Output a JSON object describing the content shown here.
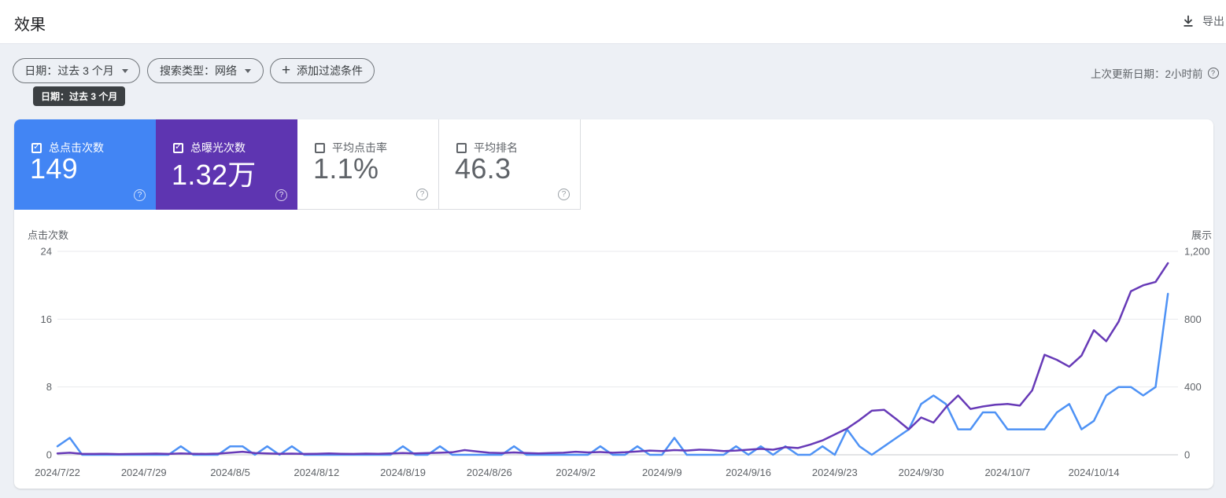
{
  "header": {
    "title": "效果",
    "export_label": "导出"
  },
  "filters": {
    "chips": [
      {
        "label": "日期：过去 3 个月"
      },
      {
        "label": "搜索类型：网络"
      },
      {
        "label": "添加过滤条件"
      }
    ],
    "tooltip": "日期：过去 3 个月",
    "last_updated": "上次更新日期：2小时前",
    "info_icon_symbol": "?"
  },
  "metric_cards": [
    {
      "label": "总点击次数",
      "value": "149",
      "checked": true,
      "color": "#4285f4"
    },
    {
      "label": "总曝光次数",
      "value": "1.32万",
      "checked": true,
      "color": "#5e35b1"
    },
    {
      "label": "平均点击率",
      "value": "1.1%",
      "checked": false,
      "color": "#ffffff"
    },
    {
      "label": "平均排名",
      "value": "46.3",
      "checked": false,
      "color": "#ffffff"
    }
  ],
  "chart_data": {
    "type": "line",
    "start_date": "2024/7/22",
    "interval": "day",
    "x_tick_labels": [
      "2024/7/22",
      "2024/7/29",
      "2024/8/5",
      "2024/8/12",
      "2024/8/19",
      "2024/8/26",
      "2024/9/2",
      "2024/9/9",
      "2024/9/16",
      "2024/9/23",
      "2024/9/30",
      "2024/10/7",
      "2024/10/14"
    ],
    "left_axis": {
      "title": "点击次数",
      "ticks": [
        0,
        8,
        16,
        24
      ],
      "max": 24
    },
    "right_axis": {
      "title": "展示",
      "ticks": [
        "0",
        "400",
        "800",
        "1,200"
      ],
      "tick_values": [
        0,
        400,
        800,
        1200
      ],
      "max": 1200
    },
    "grid": "horizontal-only",
    "series": [
      {
        "name": "点击次数",
        "axis": "left",
        "color": "#4e92f5",
        "values": [
          1,
          2,
          0,
          0,
          0,
          0,
          0,
          0,
          0,
          0,
          1,
          0,
          0,
          0,
          1,
          1,
          0,
          1,
          0,
          1,
          0,
          0,
          0,
          0,
          0,
          0,
          0,
          0,
          1,
          0,
          0,
          1,
          0,
          0,
          0,
          0,
          0,
          1,
          0,
          0,
          0,
          0,
          0,
          0,
          1,
          0,
          0,
          1,
          0,
          0,
          2,
          0,
          0,
          0,
          0,
          1,
          0,
          1,
          0,
          1,
          0,
          0,
          1,
          0,
          3,
          1,
          0,
          1,
          2,
          3,
          6,
          7,
          6,
          3,
          3,
          5,
          5,
          3,
          3,
          3,
          3,
          5,
          6,
          3,
          4,
          7,
          8,
          8,
          7,
          8,
          19
        ]
      },
      {
        "name": "展示",
        "axis": "right",
        "color": "#673ab7",
        "values": [
          8,
          12,
          6,
          5,
          6,
          4,
          5,
          6,
          7,
          5,
          8,
          6,
          5,
          7,
          12,
          18,
          10,
          8,
          6,
          7,
          5,
          6,
          8,
          6,
          5,
          7,
          6,
          8,
          10,
          8,
          10,
          12,
          15,
          28,
          20,
          12,
          10,
          14,
          10,
          8,
          10,
          12,
          18,
          14,
          16,
          12,
          15,
          20,
          25,
          22,
          28,
          25,
          30,
          28,
          22,
          25,
          30,
          35,
          30,
          45,
          40,
          60,
          85,
          120,
          155,
          205,
          260,
          265,
          210,
          150,
          220,
          190,
          280,
          350,
          270,
          285,
          295,
          300,
          290,
          380,
          590,
          560,
          520,
          585,
          735,
          670,
          785,
          965,
          1000,
          1020,
          1130
        ]
      }
    ]
  }
}
